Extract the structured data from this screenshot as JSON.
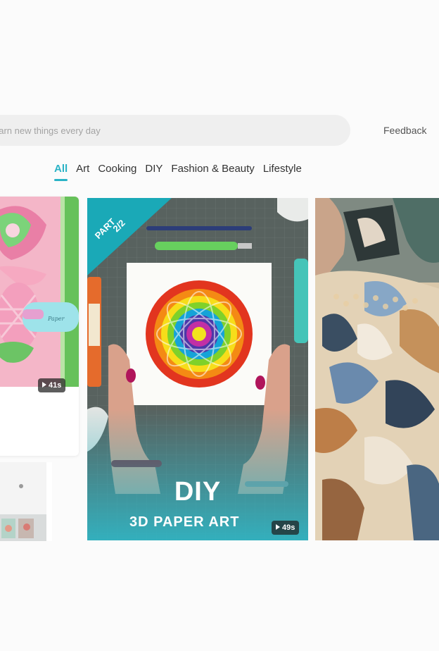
{
  "search": {
    "placeholder": "earn new things every day"
  },
  "header": {
    "feedback_label": "Feedback"
  },
  "tabs": [
    {
      "label": "All",
      "active": true
    },
    {
      "label": "Art",
      "active": false
    },
    {
      "label": "Cooking",
      "active": false
    },
    {
      "label": "DIY",
      "active": false
    },
    {
      "label": "Fashion & Beauty",
      "active": false
    },
    {
      "label": "Lifestyle",
      "active": false
    }
  ],
  "cards": {
    "left_top": {
      "duration": "41s"
    },
    "center": {
      "part_word": "PART",
      "part_number": "2/2",
      "title": "DIY",
      "subtitle": "3D PAPER ART",
      "duration": "49s"
    }
  },
  "colors": {
    "accent": "#2ab3c6",
    "search_bg": "#efefef",
    "page_bg": "#fbfbfb"
  }
}
